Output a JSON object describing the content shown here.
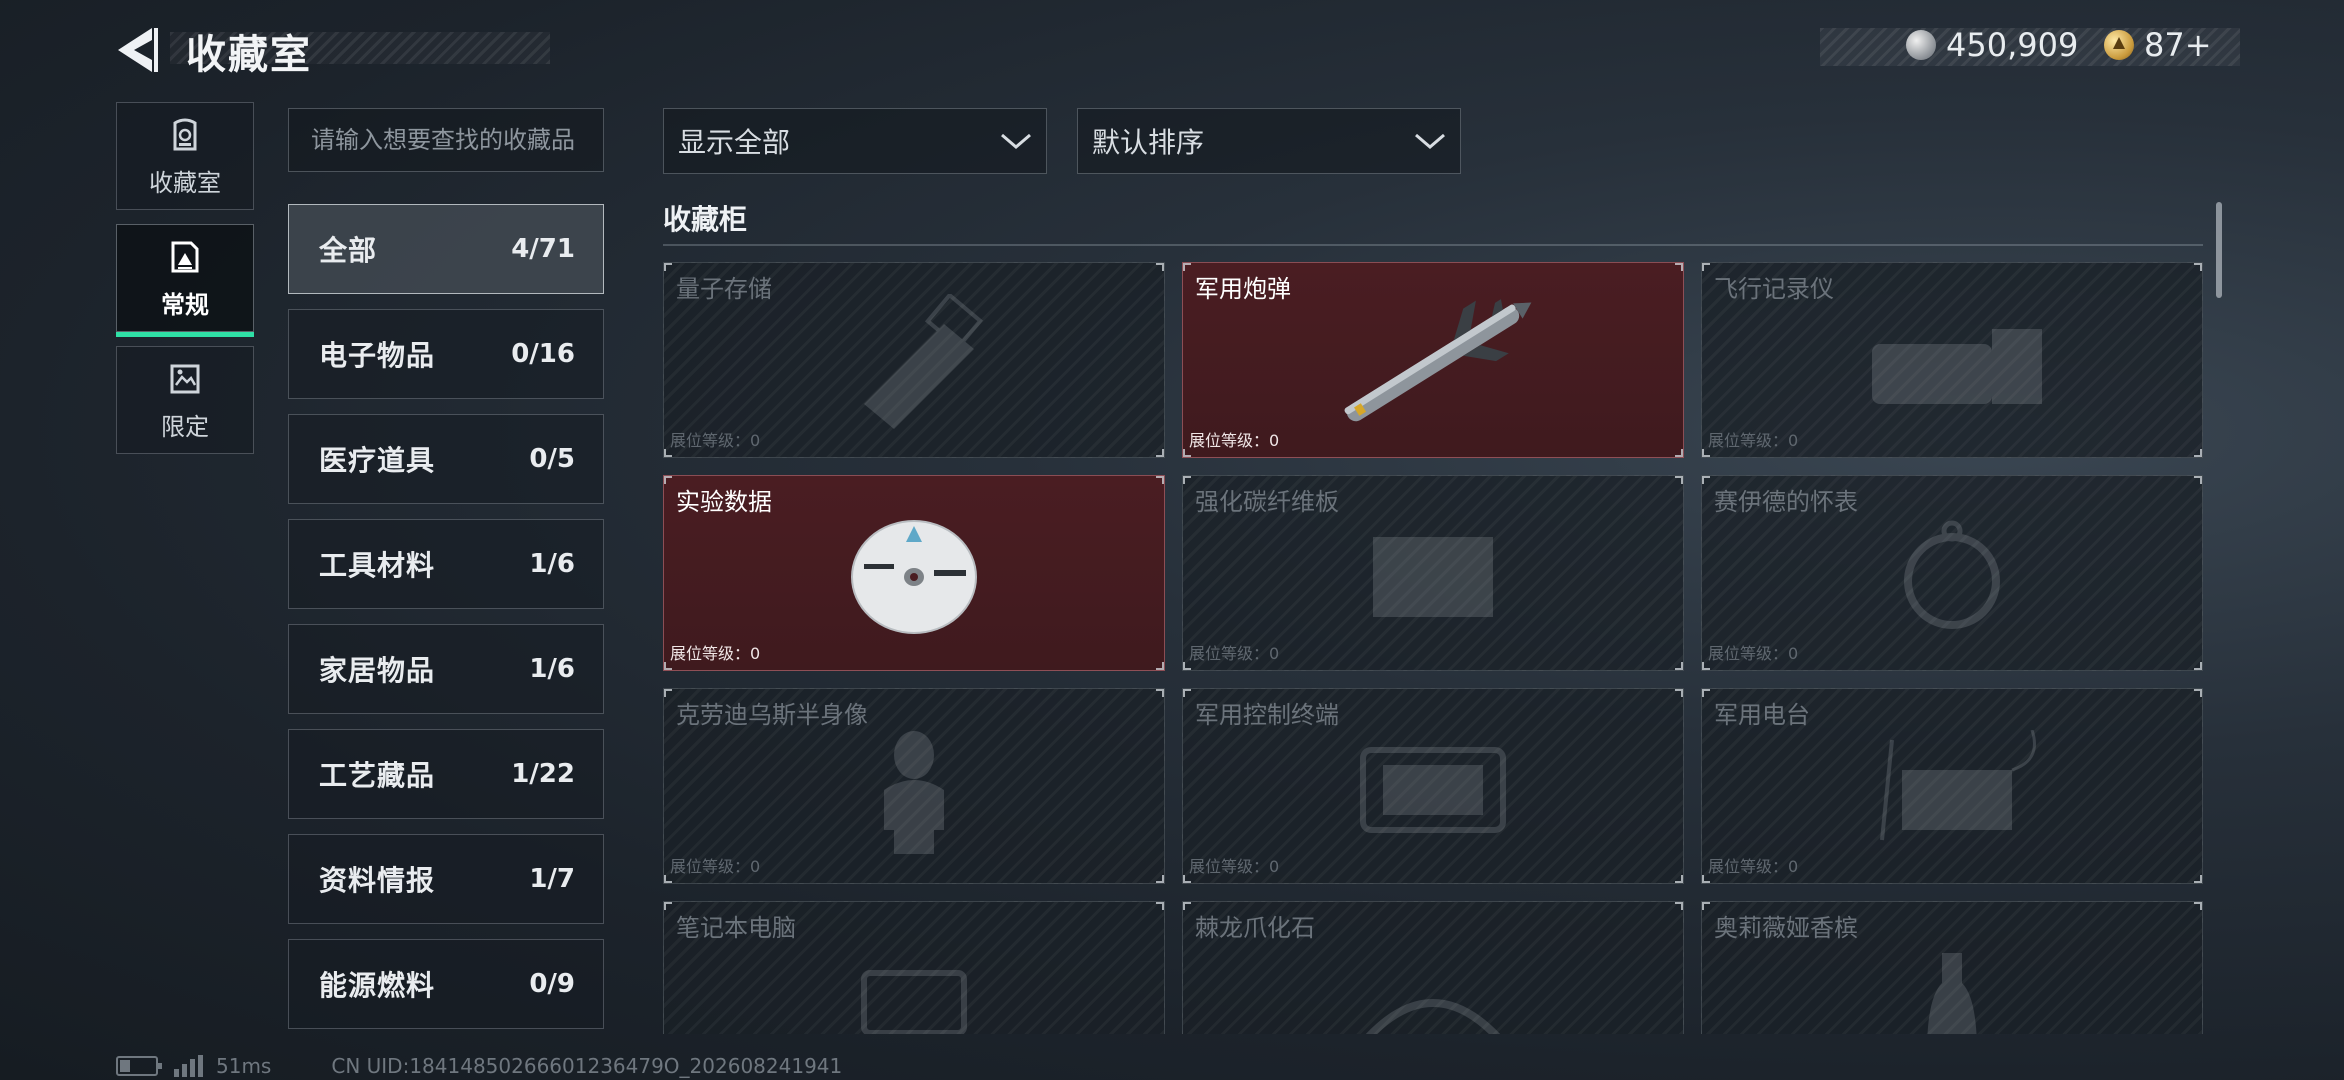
{
  "header": {
    "title": "收藏室",
    "currency_primary": "450,909",
    "currency_secondary": "87+"
  },
  "side_nav": [
    {
      "label": "收藏室",
      "icon": "vault-icon",
      "active": false
    },
    {
      "label": "常规",
      "icon": "regular-collection-icon",
      "active": true
    },
    {
      "label": "限定",
      "icon": "limited-collection-icon",
      "active": false
    }
  ],
  "search": {
    "placeholder": "请输入想要查找的收藏品"
  },
  "categories": [
    {
      "name": "全部",
      "count": "4/71",
      "active": true
    },
    {
      "name": "电子物品",
      "count": "0/16"
    },
    {
      "name": "医疗道具",
      "count": "0/5"
    },
    {
      "name": "工具材料",
      "count": "1/6"
    },
    {
      "name": "家居物品",
      "count": "1/6"
    },
    {
      "name": "工艺藏品",
      "count": "1/22"
    },
    {
      "name": "资料情报",
      "count": "1/7"
    },
    {
      "name": "能源燃料",
      "count": "0/9"
    }
  ],
  "filters": {
    "display": "显示全部",
    "sort": "默认排序"
  },
  "cabinet": {
    "title": "收藏柜",
    "items": [
      {
        "name": "量子存储",
        "level": "展位等级：0",
        "owned": false,
        "art": "usb-drive-icon"
      },
      {
        "name": "军用炮弹",
        "level": "展位等级：0",
        "owned": true,
        "art": "missile-icon"
      },
      {
        "name": "飞行记录仪",
        "level": "展位等级：0",
        "owned": false,
        "art": "flight-recorder-icon"
      },
      {
        "name": "实验数据",
        "level": "展位等级：0",
        "owned": true,
        "art": "cd-disc-icon"
      },
      {
        "name": "强化碳纤维板",
        "level": "展位等级：0",
        "owned": false,
        "art": "carbon-plate-icon"
      },
      {
        "name": "赛伊德的怀表",
        "level": "展位等级：0",
        "owned": false,
        "art": "pocket-watch-icon"
      },
      {
        "name": "克劳迪乌斯半身像",
        "level": "展位等级：0",
        "owned": false,
        "art": "bust-statue-icon"
      },
      {
        "name": "军用控制终端",
        "level": "展位等级：0",
        "owned": false,
        "art": "control-terminal-icon"
      },
      {
        "name": "军用电台",
        "level": "展位等级：0",
        "owned": false,
        "art": "military-radio-icon"
      },
      {
        "name": "笔记本电脑",
        "level": "",
        "owned": false,
        "art": "laptop-icon"
      },
      {
        "name": "棘龙爪化石",
        "level": "",
        "owned": false,
        "art": "claw-fossil-icon"
      },
      {
        "name": "奥莉薇娅香槟",
        "level": "",
        "owned": false,
        "art": "champagne-icon"
      }
    ]
  },
  "footer": {
    "ping": "51ms",
    "uid": "CN UID:18414850266601236479O_202608241941"
  },
  "colors": {
    "accent": "#2fe0a6",
    "owned_card": "#4a1d22"
  }
}
